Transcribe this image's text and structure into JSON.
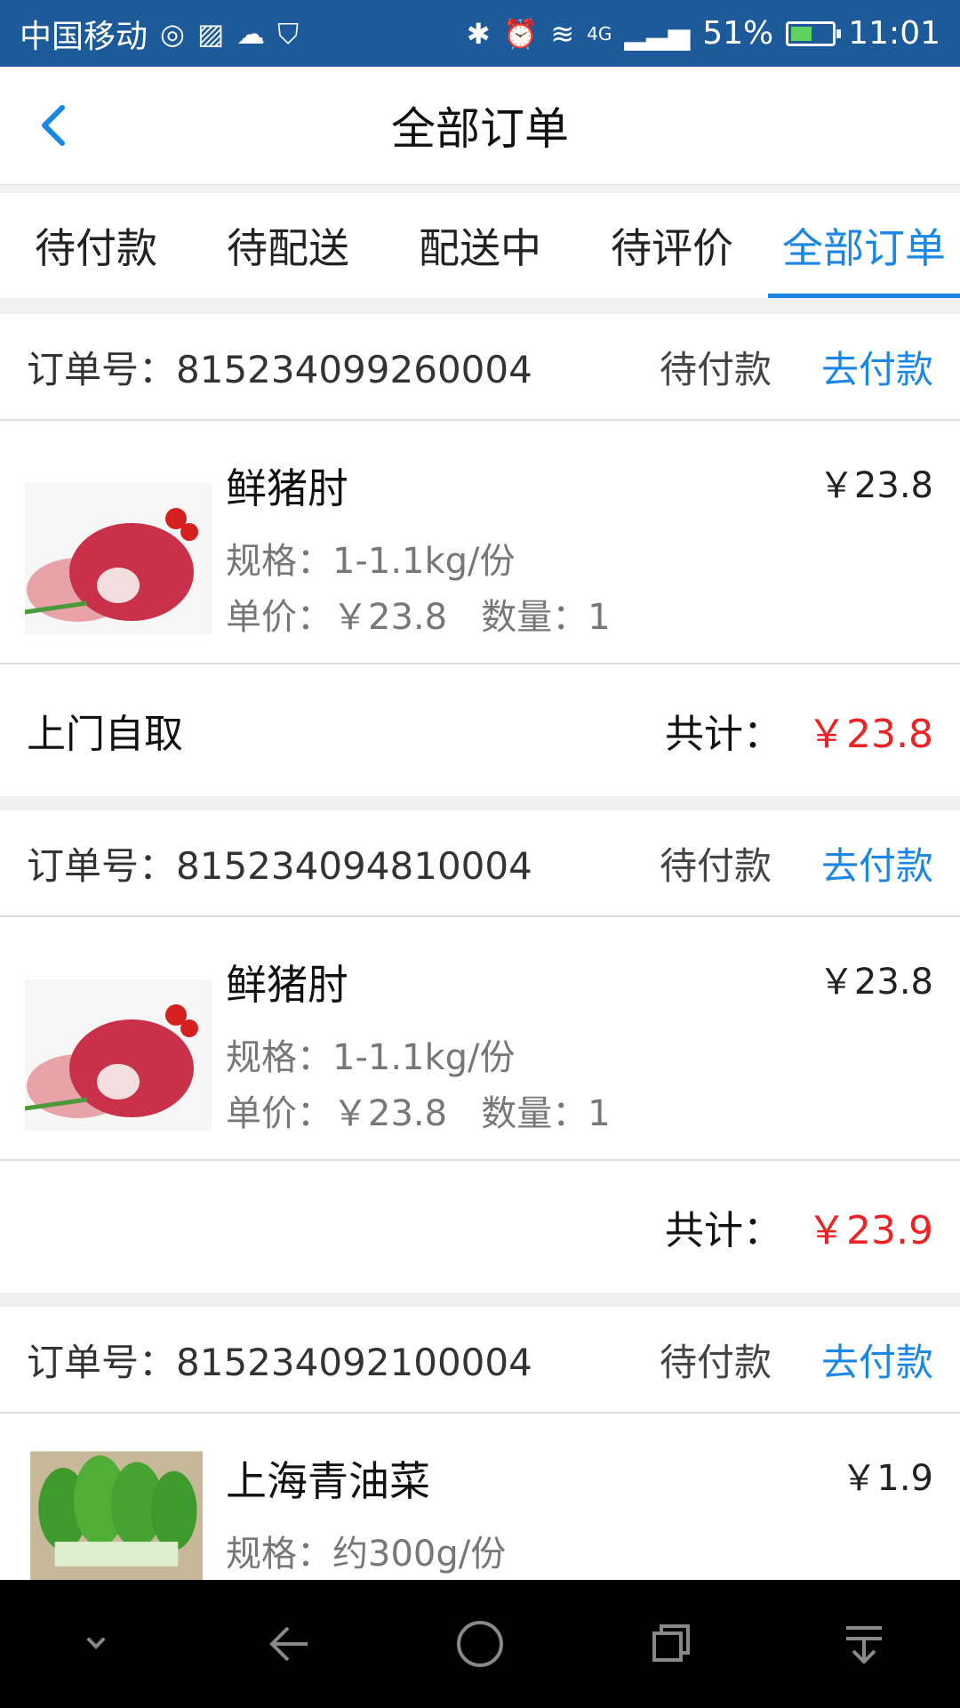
{
  "status_bar": {
    "carrier": "中国移动",
    "network": "4G",
    "battery_percent": "51%",
    "time": "11:01",
    "battery_level": 0.51
  },
  "header": {
    "title": "全部订单"
  },
  "tabs": [
    {
      "label": "待付款",
      "active": false
    },
    {
      "label": "待配送",
      "active": false
    },
    {
      "label": "配送中",
      "active": false
    },
    {
      "label": "待评价",
      "active": false
    },
    {
      "label": "全部订单",
      "active": true
    }
  ],
  "orders": [
    {
      "order_no": "订单号：815234099260004",
      "status": "待付款",
      "action": "去付款",
      "item": {
        "name": "鲜猪肘",
        "price": "￥23.8",
        "spec": "规格：1-1.1kg/份",
        "unit": "单价：￥23.8   数量：1",
        "image": "pork-hock"
      },
      "pickup": "上门自取",
      "total_label": "共计：",
      "total": "￥23.8"
    },
    {
      "order_no": "订单号：815234094810004",
      "status": "待付款",
      "action": "去付款",
      "item": {
        "name": "鲜猪肘",
        "price": "￥23.8",
        "spec": "规格：1-1.1kg/份",
        "unit": "单价：￥23.8   数量：1",
        "image": "pork-hock"
      },
      "pickup": "",
      "total_label": "共计：",
      "total": "￥23.9"
    },
    {
      "order_no": "订单号：815234092100004",
      "status": "待付款",
      "action": "去付款",
      "item": {
        "name": "上海青油菜",
        "price": "￥1.9",
        "spec": "规格：约300g/份",
        "unit": "",
        "image": "bok-choy"
      }
    }
  ],
  "colors": {
    "status_bar": "#1c5a9a",
    "accent": "#1a86e6",
    "price_red": "#e22"
  },
  "nav_icons": [
    "chevron-down-icon",
    "back-arrow-icon",
    "home-circle-icon",
    "recent-apps-icon",
    "notification-pull-icon"
  ]
}
